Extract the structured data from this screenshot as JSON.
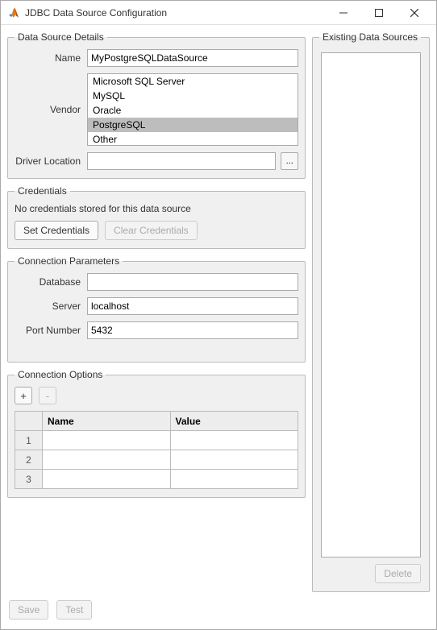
{
  "window": {
    "title": "JDBC Data Source Configuration"
  },
  "panels": {
    "details_title": "Data Source Details",
    "credentials_title": "Credentials",
    "params_title": "Connection Parameters",
    "options_title": "Connection Options",
    "existing_title": "Existing Data Sources"
  },
  "details": {
    "name_label": "Name",
    "name_value": "MyPostgreSQLDataSource",
    "vendor_label": "Vendor",
    "vendors": [
      "Microsoft SQL Server",
      "MySQL",
      "Oracle",
      "PostgreSQL",
      "Other"
    ],
    "vendor_selected": "PostgreSQL",
    "driver_label": "Driver Location",
    "driver_value": "",
    "browse_label": "..."
  },
  "credentials": {
    "note": "No credentials stored for this data source",
    "set_label": "Set Credentials",
    "clear_label": "Clear Credentials"
  },
  "params": {
    "database_label": "Database",
    "database_value": "",
    "server_label": "Server",
    "server_value": "localhost",
    "port_label": "Port Number",
    "port_value": "5432"
  },
  "options": {
    "add_label": "+",
    "remove_label": "-",
    "col_name": "Name",
    "col_value": "Value",
    "rows": [
      {
        "idx": "1",
        "name": "",
        "value": ""
      },
      {
        "idx": "2",
        "name": "",
        "value": ""
      },
      {
        "idx": "3",
        "name": "",
        "value": ""
      }
    ]
  },
  "existing": {
    "delete_label": "Delete"
  },
  "footer": {
    "save_label": "Save",
    "test_label": "Test"
  }
}
